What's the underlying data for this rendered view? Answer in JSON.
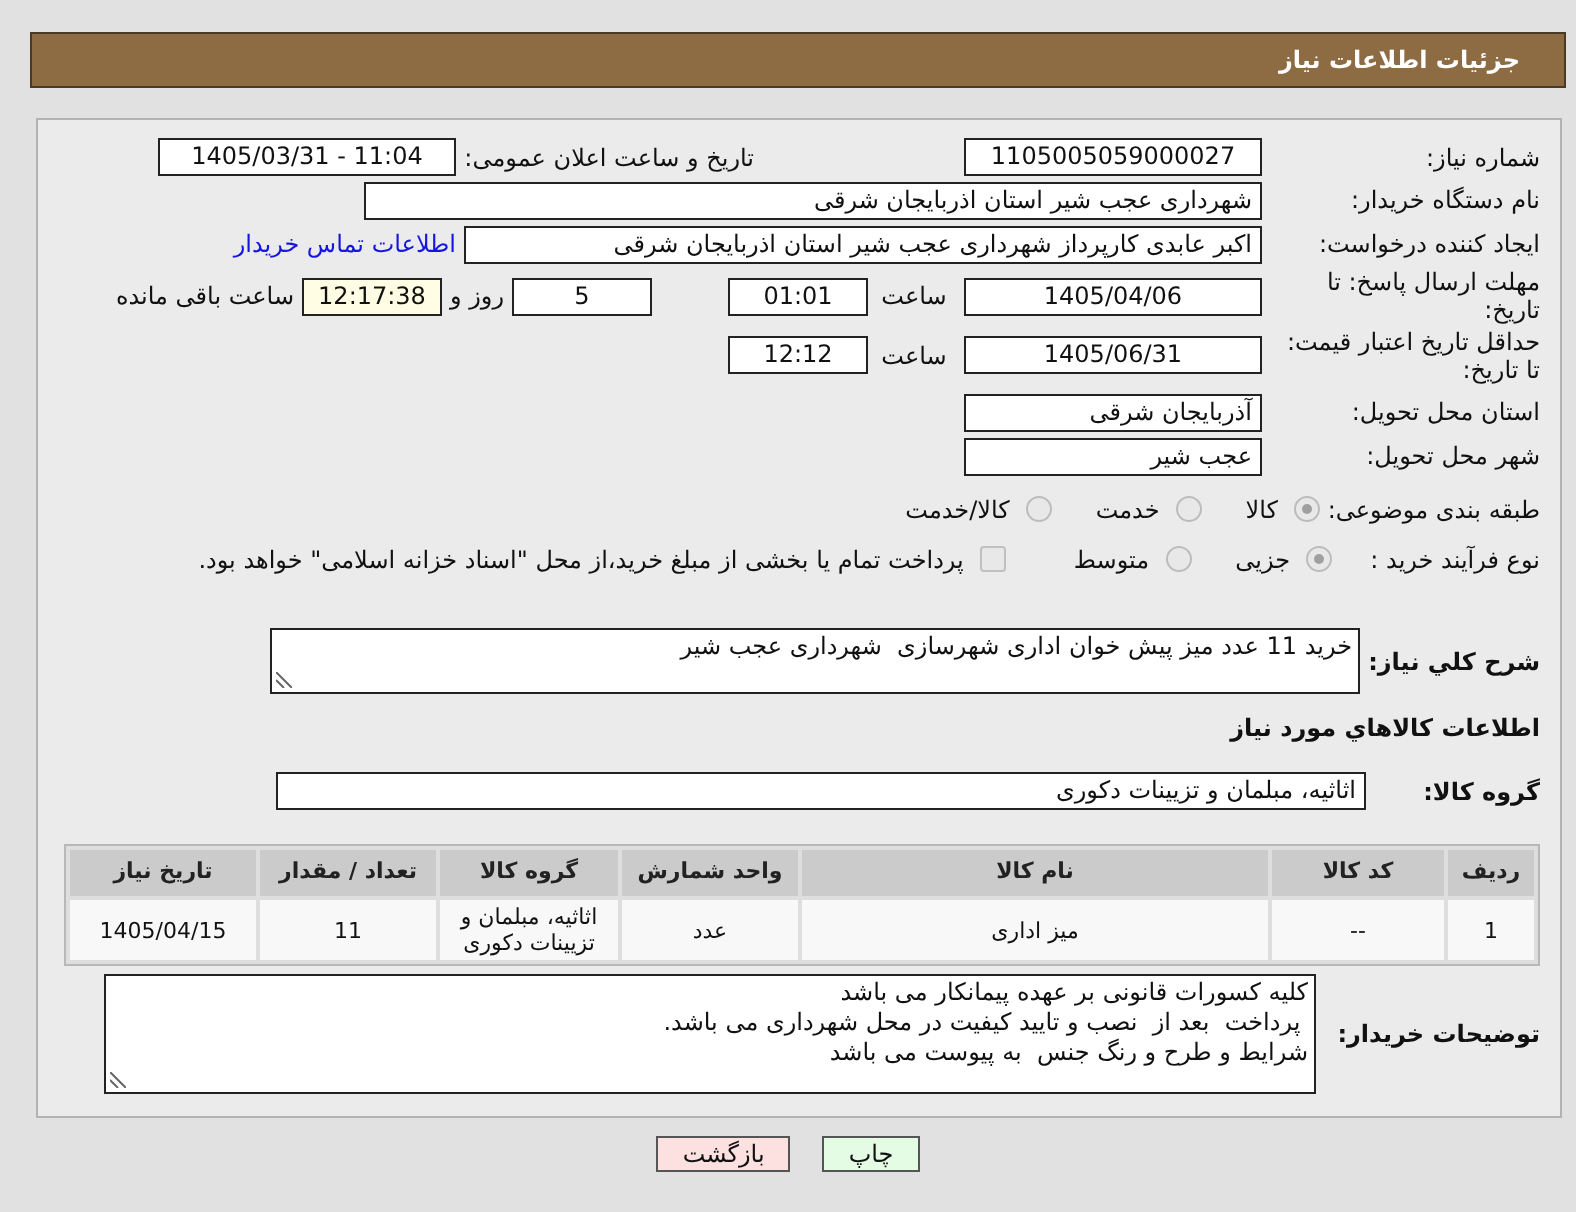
{
  "header": {
    "title": "جزئیات اطلاعات نیاز"
  },
  "details": {
    "need_number": {
      "label": "شماره نیاز:",
      "value": "1105005059000027"
    },
    "announcement": {
      "label": "تاریخ و ساعت اعلان عمومی:",
      "value": "1405/03/31 - 11:04"
    },
    "buyer_org": {
      "label": "نام دستگاه خریدار:",
      "value": "شهرداری عجب شیر استان اذربایجان شرقی"
    },
    "requester": {
      "label": "ایجاد کننده درخواست:",
      "value": "اکبر عابدی کارپرداز شهرداری عجب شیر استان اذربایجان شرقی",
      "link": "اطلاعات تماس خریدار"
    },
    "reply_deadline": {
      "label": "مهلت ارسال پاسخ: تا تاریخ:",
      "date": "1405/04/06",
      "time_label": "ساعت",
      "time": "01:01",
      "days": "5",
      "days_label": "روز و",
      "remaining": "12:17:38",
      "remaining_label": "ساعت باقی مانده"
    },
    "price_validity": {
      "label": "حداقل تاریخ اعتبار قیمت: تا تاریخ:",
      "date": "1405/06/31",
      "time_label": "ساعت",
      "time": "12:12"
    },
    "delivery_province": {
      "label": "استان محل تحویل:",
      "value": "آذربایجان شرقی"
    },
    "delivery_city": {
      "label": "شهر محل تحویل:",
      "value": "عجب شیر"
    },
    "subject_category": {
      "label": "طبقه بندی موضوعی:",
      "options": [
        {
          "label": "کالا",
          "selected": true
        },
        {
          "label": "خدمت",
          "selected": false
        },
        {
          "label": "کالا/خدمت",
          "selected": false
        }
      ]
    },
    "purchase_process": {
      "label": "نوع فرآیند خرید :",
      "options": [
        {
          "label": "جزیی",
          "selected": true
        },
        {
          "label": "متوسط",
          "selected": false
        }
      ],
      "treasury_payment": {
        "label": "پرداخت تمام یا بخشی از مبلغ خرید،از محل \"اسناد خزانه اسلامی\" خواهد بود.",
        "checked": false
      }
    }
  },
  "description": {
    "label": "شرح کلي نياز:",
    "value": "خرید 11 عدد میز پیش خوان اداری شهرسازی  شهرداری عجب شیر"
  },
  "goods": {
    "title": "اطلاعات کالاهاي مورد نياز",
    "group_label": "گروه کالا:",
    "group_value": "اثاثیه، مبلمان و تزیینات دکوری",
    "table": {
      "columns": [
        "ردیف",
        "کد کالا",
        "نام کالا",
        "واحد شمارش",
        "گروه کالا",
        "تعداد / مقدار",
        "تاریخ نیاز"
      ],
      "rows": [
        [
          "1",
          "--",
          "میز اداری",
          "عدد",
          "اثاثیه، مبلمان و تزیینات دکوری",
          "11",
          "1405/04/15"
        ]
      ]
    }
  },
  "buyer_notes": {
    "label": "توضیحات خریدار:",
    "value": "کلیه کسورات قانونی بر عهده پیمانکار می باشد\n پرداخت  بعد از  نصب و تایید کیفیت در محل شهرداری می باشد.\nشرایط و طرح و رنگ جنس  به پیوست می باشد"
  },
  "buttons": [
    {
      "label": "چاپ",
      "kind": "print"
    },
    {
      "label": "بازگشت",
      "kind": "back"
    }
  ]
}
